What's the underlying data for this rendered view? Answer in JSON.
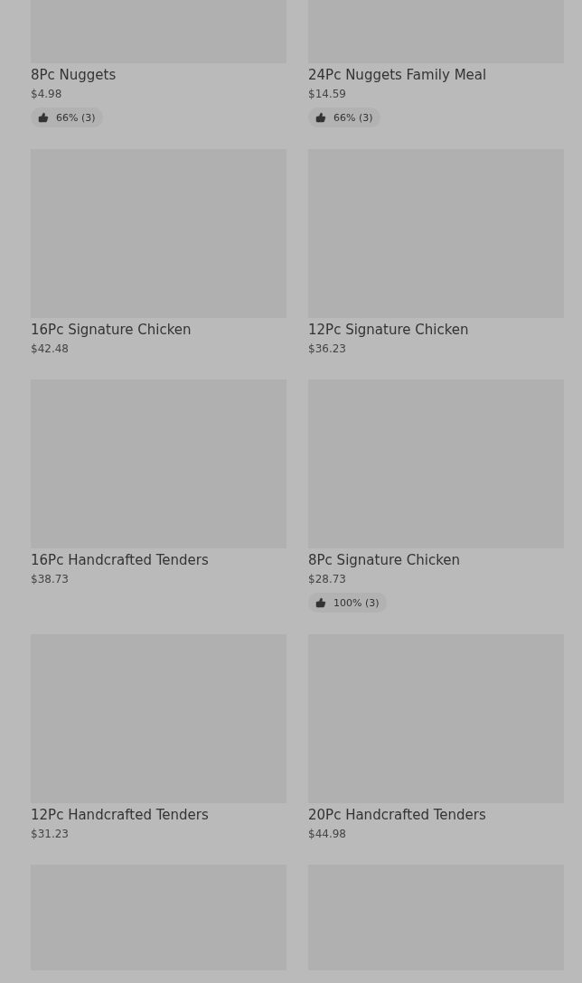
{
  "items": [
    {
      "kind": "product",
      "name": "8Pc Nuggets",
      "price": "$4.98",
      "rating": "66% (3)"
    },
    {
      "kind": "product",
      "name": "24Pc Nuggets Family Meal",
      "price": "$14.59",
      "rating": "66% (3)"
    },
    {
      "kind": "product",
      "name": "16Pc Signature Chicken",
      "price": "$42.48"
    },
    {
      "kind": "product",
      "name": "12Pc Signature Chicken",
      "price": "$36.23"
    },
    {
      "kind": "product",
      "name": "16Pc Handcrafted Tenders",
      "price": "$38.73"
    },
    {
      "kind": "product",
      "name": "8Pc Signature Chicken",
      "price": "$28.73",
      "rating": "100% (3)"
    },
    {
      "kind": "product",
      "name": "12Pc Handcrafted Tenders",
      "price": "$31.23"
    },
    {
      "kind": "product",
      "name": "20Pc Handcrafted Tenders",
      "price": "$44.98"
    },
    {
      "kind": "image_only"
    },
    {
      "kind": "image_only"
    }
  ]
}
